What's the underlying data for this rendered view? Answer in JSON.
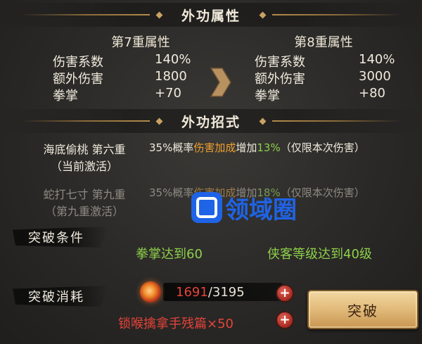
{
  "headers": {
    "outer_attr": "外功属性",
    "outer_moves": "外功招式"
  },
  "current": {
    "title": "第7重属性",
    "rows": [
      {
        "name": "伤害系数",
        "value": "140%"
      },
      {
        "name": "额外伤害",
        "value": "1800"
      },
      {
        "name": "拳掌",
        "value": "+70"
      }
    ]
  },
  "next": {
    "title": "第8重属性",
    "rows": [
      {
        "name": "伤害系数",
        "value": "140%"
      },
      {
        "name": "额外伤害",
        "value": "3000"
      },
      {
        "name": "拳掌",
        "value": "+80"
      }
    ]
  },
  "skills": [
    {
      "name": "海底偷桃 第六重",
      "status": "（当前激活）",
      "desc_pre": "35%概率",
      "desc_hl": "伤害加成",
      "desc_mid": "增加",
      "desc_pct": "13%",
      "desc_post": "（仅限本次伤害）"
    },
    {
      "name": "蛇打七寸 第九重",
      "status": "（第九重激活）",
      "desc_pre": "35%概率",
      "desc_hl": "伤害加成",
      "desc_mid": "增加",
      "desc_pct": "18%",
      "desc_post": "（仅限本次伤害）"
    }
  ],
  "conditions": {
    "label": "突破条件",
    "items": [
      "拳掌达到60",
      "侠客等级达到40级"
    ]
  },
  "cost": {
    "label": "突破消耗",
    "current": "1691",
    "total": "/3195",
    "item": "锁喉擒拿手残篇×50"
  },
  "button": {
    "label": "突破"
  },
  "watermark": "领域圈",
  "colors": {
    "highlight": "#f0a030",
    "green": "#8ed04a",
    "red": "#e5433a",
    "button": "#e3bd7d"
  }
}
